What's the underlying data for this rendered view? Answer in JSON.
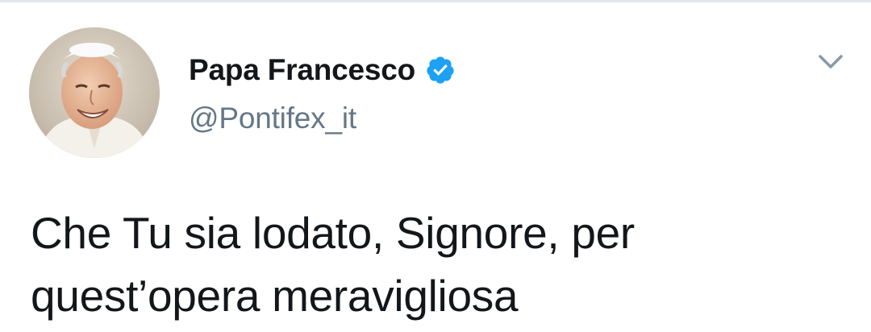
{
  "author": {
    "display_name": "Papa Francesco",
    "handle": "@Pontifex_it",
    "verified": true
  },
  "tweet": {
    "line_1": "Che Tu sia lodato, Signore, per",
    "line_2": "quest’opera meravigliosa"
  },
  "icons": {
    "verified": "verified-badge-icon",
    "menu": "chevron-down-icon"
  },
  "colors": {
    "verified_blue": "#1da1f2",
    "handle_gray": "#657786",
    "text": "#14171a",
    "caret_gray": "#8899a6"
  }
}
